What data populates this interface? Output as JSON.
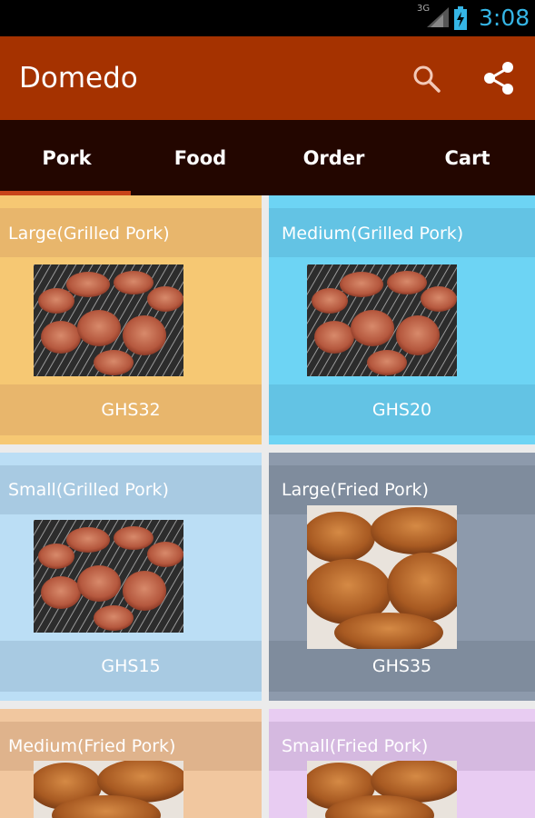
{
  "status_bar": {
    "network": "3G",
    "time": "3:08",
    "clock_color": "#35b5e5"
  },
  "app_bar": {
    "title": "Domedo",
    "background": "#a53200",
    "search_icon": "search-icon",
    "share_icon": "share-icon"
  },
  "tabs": [
    {
      "label": "Pork",
      "selected": true
    },
    {
      "label": "Food",
      "selected": false
    },
    {
      "label": "Order",
      "selected": false
    },
    {
      "label": "Cart",
      "selected": false
    }
  ],
  "products": [
    {
      "name": "Large(Grilled Pork)",
      "price": "GHS32",
      "image": "grilled-pork-photo",
      "color": "#f6c873",
      "band": "#e8b66c"
    },
    {
      "name": "Medium(Grilled Pork)",
      "price": "GHS20",
      "image": "grilled-pork-photo",
      "color": "#6dd4f4",
      "band": "#63c3e4"
    },
    {
      "name": "Small(Grilled Pork)",
      "price": "GHS15",
      "image": "grilled-pork-photo",
      "color": "#bbdef5",
      "band": "#a8cae2"
    },
    {
      "name": "Large(Fried Pork)",
      "price": "GHS35",
      "image": "fried-pork-photo",
      "color": "#8d9aac",
      "band": "#7f8c9d"
    },
    {
      "name": "Medium(Fried Pork)",
      "price": "",
      "image": "fried-pork-photo",
      "color": "#f1c79f",
      "band": "#dfb38c"
    },
    {
      "name": "Small(Fried Pork)",
      "price": "",
      "image": "fried-pork-photo",
      "color": "#e8ccf2",
      "band": "#d5b9e0"
    }
  ]
}
